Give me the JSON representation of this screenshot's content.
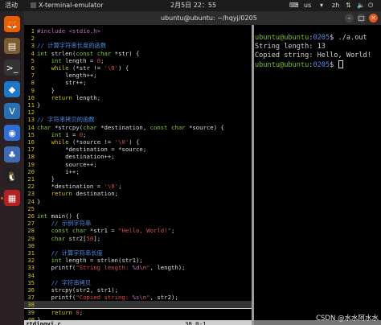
{
  "topbar": {
    "activities": "活动",
    "app_name": "X-terminal-emulator",
    "clock": "2月5日  22：55",
    "lang": "us",
    "input_method": "zh"
  },
  "window": {
    "title": "ubuntu@ubuntu: ~/hqyj/0205",
    "minimize": "–",
    "maximize": "□",
    "close": "✕"
  },
  "dock": [
    {
      "name": "firefox-icon",
      "glyph": "🦊",
      "color": "#e66000"
    },
    {
      "name": "files-icon",
      "glyph": "▤",
      "color": "#7a5c2e"
    },
    {
      "name": "terminal-icon",
      "glyph": ">_",
      "color": "#333333"
    },
    {
      "name": "vscode-icon",
      "glyph": "◆",
      "color": "#1e78c8"
    },
    {
      "name": "vbox-icon",
      "glyph": "V",
      "color": "#2a6fb0"
    },
    {
      "name": "screenshot-icon",
      "glyph": "◉",
      "color": "#2f6dd1"
    },
    {
      "name": "network-icon",
      "glyph": "♣",
      "color": "#3d6ab0"
    },
    {
      "name": "qq-icon",
      "glyph": "🐧",
      "color": "#222222"
    },
    {
      "name": "presentation-icon",
      "glyph": "▦",
      "color": "#b22222"
    }
  ],
  "vim": {
    "lines": [
      {
        "n": "1",
        "segs": [
          {
            "t": "#include <stdio.h>",
            "c": "#c06ec0"
          }
        ]
      },
      {
        "n": "2",
        "segs": []
      },
      {
        "n": "3",
        "segs": [
          {
            "t": "// 计算字符串长度的函数",
            "c": "#4c8be0"
          }
        ]
      },
      {
        "n": "4",
        "segs": [
          {
            "t": "int",
            "c": "#8ec93a"
          },
          {
            "t": " strlen(",
            "c": "#dddddd"
          },
          {
            "t": "const char",
            "c": "#8ec93a"
          },
          {
            "t": " *str) {",
            "c": "#dddddd"
          }
        ]
      },
      {
        "n": "5",
        "segs": [
          {
            "t": "    ",
            "c": "#dddddd"
          },
          {
            "t": "int",
            "c": "#8ec93a"
          },
          {
            "t": " length = ",
            "c": "#dddddd"
          },
          {
            "t": "0",
            "c": "#e04b4b"
          },
          {
            "t": ";",
            "c": "#dddddd"
          }
        ]
      },
      {
        "n": "6",
        "segs": [
          {
            "t": "    ",
            "c": "#dddddd"
          },
          {
            "t": "while",
            "c": "#d8c20c"
          },
          {
            "t": " (*str != ",
            "c": "#dddddd"
          },
          {
            "t": "'\\0'",
            "c": "#e04b4b"
          },
          {
            "t": ") {",
            "c": "#dddddd"
          }
        ]
      },
      {
        "n": "7",
        "segs": [
          {
            "t": "        length++;",
            "c": "#dddddd"
          }
        ]
      },
      {
        "n": "8",
        "segs": [
          {
            "t": "        str++;",
            "c": "#dddddd"
          }
        ]
      },
      {
        "n": "9",
        "segs": [
          {
            "t": "    }",
            "c": "#dddddd"
          }
        ]
      },
      {
        "n": "10",
        "segs": [
          {
            "t": "    ",
            "c": "#dddddd"
          },
          {
            "t": "return",
            "c": "#d8c20c"
          },
          {
            "t": " length;",
            "c": "#dddddd"
          }
        ]
      },
      {
        "n": "11",
        "segs": [
          {
            "t": "}",
            "c": "#dddddd"
          }
        ]
      },
      {
        "n": "12",
        "segs": []
      },
      {
        "n": "13",
        "segs": [
          {
            "t": "// 字符串拷贝的函数",
            "c": "#4c8be0"
          }
        ]
      },
      {
        "n": "14",
        "segs": [
          {
            "t": "char",
            "c": "#8ec93a"
          },
          {
            "t": " *strcpy(",
            "c": "#dddddd"
          },
          {
            "t": "char",
            "c": "#8ec93a"
          },
          {
            "t": " *destination, ",
            "c": "#dddddd"
          },
          {
            "t": "const char",
            "c": "#8ec93a"
          },
          {
            "t": " *source) {",
            "c": "#dddddd"
          }
        ]
      },
      {
        "n": "15",
        "segs": [
          {
            "t": "    ",
            "c": "#dddddd"
          },
          {
            "t": "int",
            "c": "#8ec93a"
          },
          {
            "t": " i = ",
            "c": "#dddddd"
          },
          {
            "t": "0",
            "c": "#e04b4b"
          },
          {
            "t": ";",
            "c": "#dddddd"
          }
        ]
      },
      {
        "n": "16",
        "segs": [
          {
            "t": "    ",
            "c": "#dddddd"
          },
          {
            "t": "while",
            "c": "#d8c20c"
          },
          {
            "t": " (*source != ",
            "c": "#dddddd"
          },
          {
            "t": "'\\0'",
            "c": "#e04b4b"
          },
          {
            "t": ") {",
            "c": "#dddddd"
          }
        ]
      },
      {
        "n": "17",
        "segs": [
          {
            "t": "        *destination = *source;",
            "c": "#dddddd"
          }
        ]
      },
      {
        "n": "18",
        "segs": [
          {
            "t": "        destination++;",
            "c": "#dddddd"
          }
        ]
      },
      {
        "n": "19",
        "segs": [
          {
            "t": "        source++;",
            "c": "#dddddd"
          }
        ]
      },
      {
        "n": "20",
        "segs": [
          {
            "t": "        i++;",
            "c": "#dddddd"
          }
        ]
      },
      {
        "n": "21",
        "segs": [
          {
            "t": "    }",
            "c": "#dddddd"
          }
        ]
      },
      {
        "n": "22",
        "segs": [
          {
            "t": "    *destination = ",
            "c": "#dddddd"
          },
          {
            "t": "'\\0'",
            "c": "#e04b4b"
          },
          {
            "t": ";",
            "c": "#dddddd"
          }
        ]
      },
      {
        "n": "23",
        "segs": [
          {
            "t": "    ",
            "c": "#dddddd"
          },
          {
            "t": "return",
            "c": "#d8c20c"
          },
          {
            "t": " destination;",
            "c": "#dddddd"
          }
        ]
      },
      {
        "n": "24",
        "segs": [
          {
            "t": "}",
            "c": "#dddddd"
          }
        ]
      },
      {
        "n": "25",
        "segs": []
      },
      {
        "n": "26",
        "segs": [
          {
            "t": "int",
            "c": "#8ec93a"
          },
          {
            "t": " main() {",
            "c": "#dddddd"
          }
        ]
      },
      {
        "n": "27",
        "segs": [
          {
            "t": "    // 示例字符串",
            "c": "#4c8be0"
          }
        ]
      },
      {
        "n": "28",
        "segs": [
          {
            "t": "    ",
            "c": "#dddddd"
          },
          {
            "t": "const char",
            "c": "#8ec93a"
          },
          {
            "t": " *str1 = ",
            "c": "#dddddd"
          },
          {
            "t": "\"Hello, World!\"",
            "c": "#e04b4b"
          },
          {
            "t": ";",
            "c": "#dddddd"
          }
        ]
      },
      {
        "n": "29",
        "segs": [
          {
            "t": "    ",
            "c": "#dddddd"
          },
          {
            "t": "char",
            "c": "#8ec93a"
          },
          {
            "t": " str2[",
            "c": "#dddddd"
          },
          {
            "t": "50",
            "c": "#e04b4b"
          },
          {
            "t": "];",
            "c": "#dddddd"
          }
        ]
      },
      {
        "n": "30",
        "segs": []
      },
      {
        "n": "31",
        "segs": [
          {
            "t": "    // 计算字符串长度",
            "c": "#4c8be0"
          }
        ]
      },
      {
        "n": "32",
        "segs": [
          {
            "t": "    ",
            "c": "#dddddd"
          },
          {
            "t": "int",
            "c": "#8ec93a"
          },
          {
            "t": " length = strlen(str1);",
            "c": "#dddddd"
          }
        ]
      },
      {
        "n": "33",
        "segs": [
          {
            "t": "    printf(",
            "c": "#dddddd"
          },
          {
            "t": "\"String length: ",
            "c": "#e04b4b"
          },
          {
            "t": "%d\\n",
            "c": "#c06ec0"
          },
          {
            "t": "\"",
            "c": "#e04b4b"
          },
          {
            "t": ", length);",
            "c": "#dddddd"
          }
        ]
      },
      {
        "n": "34",
        "segs": []
      },
      {
        "n": "35",
        "segs": [
          {
            "t": "    // 字符串拷贝",
            "c": "#4c8be0"
          }
        ]
      },
      {
        "n": "36",
        "segs": [
          {
            "t": "    strcpy(str2, str1);",
            "c": "#dddddd"
          }
        ]
      },
      {
        "n": "37",
        "segs": [
          {
            "t": "    printf(",
            "c": "#dddddd"
          },
          {
            "t": "\"Copied string: ",
            "c": "#e04b4b"
          },
          {
            "t": "%s\\n",
            "c": "#c06ec0"
          },
          {
            "t": "\"",
            "c": "#e04b4b"
          },
          {
            "t": ", str2);",
            "c": "#dddddd"
          }
        ]
      },
      {
        "n": "38",
        "segs": [],
        "cursor": true
      },
      {
        "n": "39",
        "segs": [
          {
            "t": "    ",
            "c": "#dddddd"
          },
          {
            "t": "return",
            "c": "#d8c20c"
          },
          {
            "t": " ",
            "c": "#dddddd"
          },
          {
            "t": "0",
            "c": "#e04b4b"
          },
          {
            "t": ";",
            "c": "#dddddd"
          }
        ]
      },
      {
        "n": "40",
        "segs": [
          {
            "t": "}",
            "c": "#dddddd"
          }
        ]
      }
    ],
    "tilde": "~",
    "status_file": "ztdingyi.c",
    "status_pos": "38,0-1"
  },
  "terminal": {
    "prompt_user": "ubuntu@ubuntu",
    "prompt_sep": ":",
    "prompt_path": "0205",
    "prompt_dollar": "$ ",
    "command": "./a.out",
    "out1": "String length: 13",
    "out2": "Copied string: Hello, World!"
  },
  "watermark": "CSDN @水水阿水水"
}
